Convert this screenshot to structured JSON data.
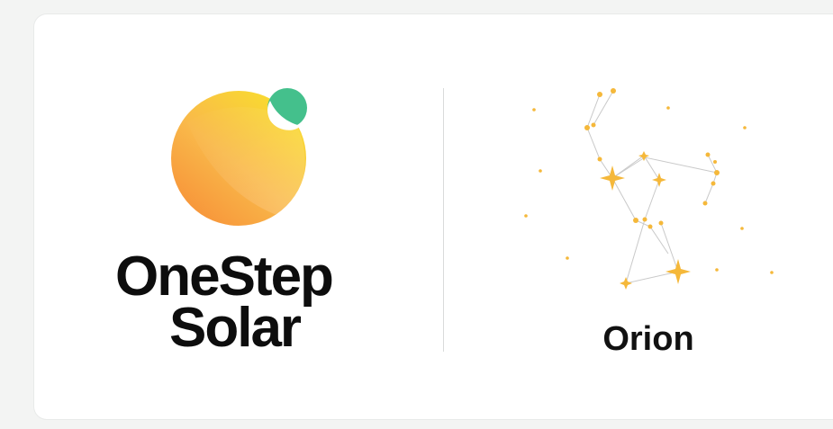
{
  "brand": {
    "line1": "OneStep",
    "line2": "Solar",
    "logo_icon": "sun-globe-logo",
    "colors": {
      "sun_light": "#f8d634",
      "sun_dark": "#f7a03c",
      "accent_green": "#44c08c",
      "text": "#0d0d0d"
    }
  },
  "product": {
    "name": "Orion",
    "icon": "orion-constellation-icon",
    "star_color": "#f5b83a",
    "line_color": "#c9c9c9"
  }
}
